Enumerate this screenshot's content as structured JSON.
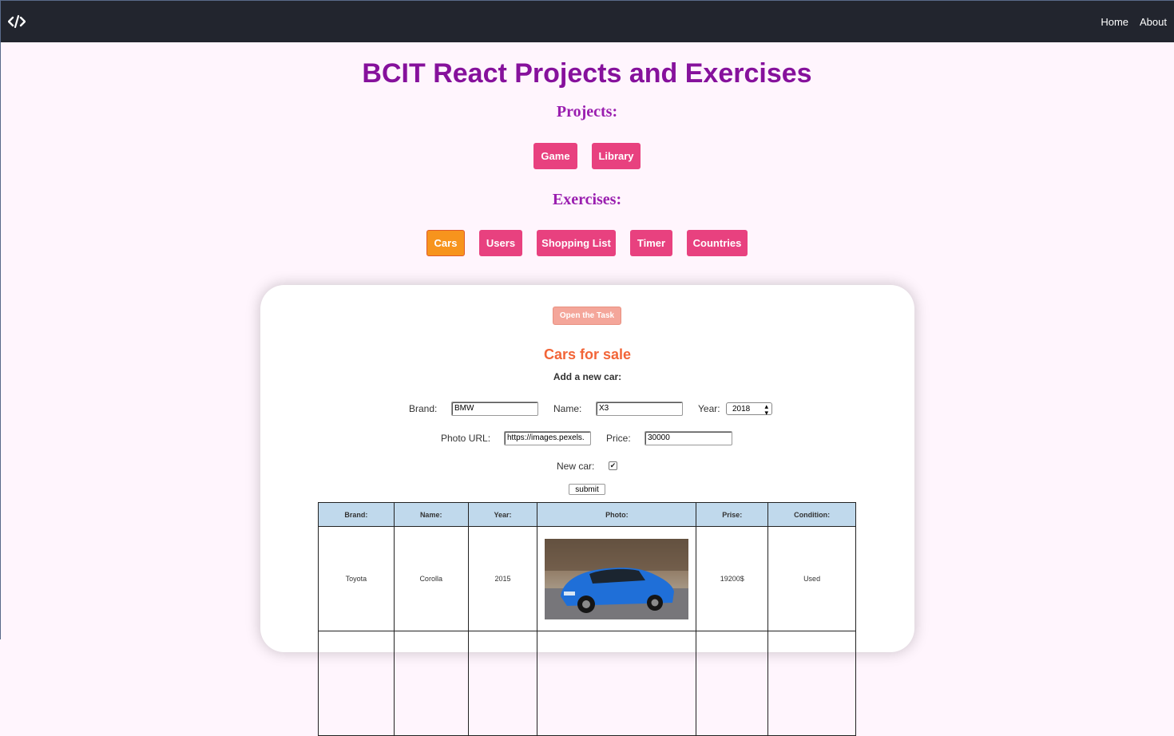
{
  "nav": {
    "logo_icon": "code-icon",
    "links": [
      "Home",
      "About"
    ]
  },
  "page": {
    "title": "BCIT React Projects and Exercises",
    "projects_label": "Projects:",
    "projects": [
      "Game",
      "Library"
    ],
    "exercises_label": "Exercises:",
    "exercises": [
      "Cars",
      "Users",
      "Shopping List",
      "Timer",
      "Countries"
    ],
    "active_exercise": "Cars"
  },
  "colors": {
    "navbar": "#22252e",
    "background": "#fff5fd",
    "title": "#86119c",
    "button": "#e8417f",
    "active_button": "#f7941d",
    "cars_title": "#f26538",
    "table_header": "#c0d9ec"
  },
  "card": {
    "task_button": "Open the Task",
    "title": "Cars for sale",
    "subtitle": "Add a new car:",
    "form": {
      "brand_label": "Brand:",
      "brand_value": "BMW",
      "name_label": "Name:",
      "name_value": "X3",
      "year_label": "Year:",
      "year_value": "2018",
      "photo_label": "Photo URL:",
      "photo_value": "https://images.pexels.",
      "price_label": "Price:",
      "price_value": "30000",
      "new_label": "New car:",
      "new_checked": true,
      "submit": "submit"
    },
    "table": {
      "headers": [
        "Brand:",
        "Name:",
        "Year:",
        "Photo:",
        "Prise:",
        "Condition:"
      ],
      "rows": [
        {
          "brand": "Toyota",
          "name": "Corolla",
          "year": "2015",
          "photo": "blue car photo",
          "price": "19200$",
          "condition": "Used"
        }
      ]
    }
  }
}
